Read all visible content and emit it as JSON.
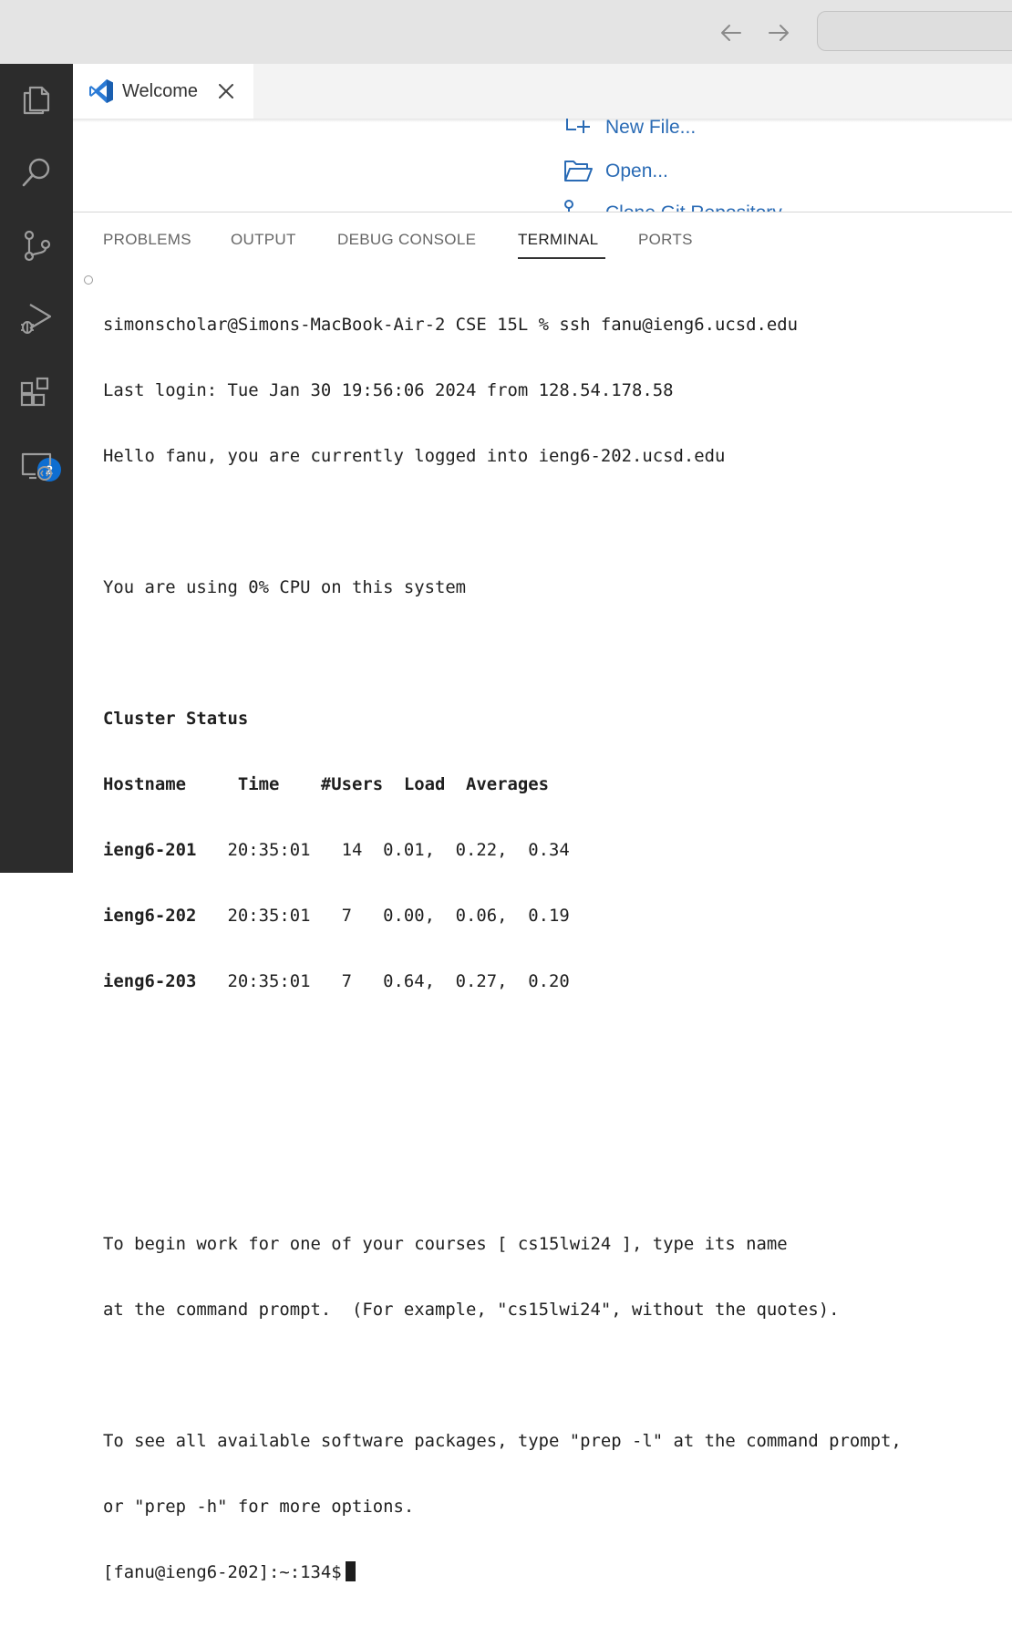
{
  "titlebar": {
    "back_icon": "arrow-left-icon",
    "forward_icon": "arrow-right-icon"
  },
  "activity_bar": {
    "items": [
      {
        "name": "explorer",
        "icon": "files-icon"
      },
      {
        "name": "search",
        "icon": "search-icon"
      },
      {
        "name": "source-control",
        "icon": "source-control-icon"
      },
      {
        "name": "run-debug",
        "icon": "run-debug-icon"
      },
      {
        "name": "extensions",
        "icon": "extensions-icon",
        "badge": "2"
      },
      {
        "name": "remote-explorer",
        "icon": "remote-explorer-icon"
      }
    ],
    "extensions_badge": "2"
  },
  "editor": {
    "tab": {
      "title": "Welcome",
      "icon": "vscode-icon",
      "close_icon": "close-icon"
    },
    "welcome_links": {
      "new_file": "New File...",
      "open": "Open...",
      "clone": "Clone Git Repository..."
    }
  },
  "panel": {
    "tabs": [
      "PROBLEMS",
      "OUTPUT",
      "DEBUG CONSOLE",
      "TERMINAL",
      "PORTS"
    ],
    "active_tab": "TERMINAL"
  },
  "terminal": {
    "command_line": "simonscholar@Simons-MacBook-Air-2 CSE 15L % ssh fanu@ieng6.ucsd.edu",
    "last_login": "Last login: Tue Jan 30 19:56:06 2024 from 128.54.178.58",
    "hello": "Hello fanu, you are currently logged into ieng6-202.ucsd.edu",
    "cpu": "You are using 0% CPU on this system",
    "cluster_title": "Cluster Status",
    "cluster_header": "Hostname     Time    #Users  Load  Averages",
    "cluster_rows": [
      {
        "host": "ieng6-201",
        "rest": "   20:35:01   14  0.01,  0.22,  0.34"
      },
      {
        "host": "ieng6-202",
        "rest": "   20:35:01   7   0.00,  0.06,  0.19"
      },
      {
        "host": "ieng6-203",
        "rest": "   20:35:01   7   0.64,  0.27,  0.20"
      }
    ],
    "begin_1": "To begin work for one of your courses [ cs15lwi24 ], type its name",
    "begin_2": "at the command prompt.  (For example, \"cs15lwi24\", without the quotes).",
    "prep_1": "To see all available software packages, type \"prep -l\" at the command prompt,",
    "prep_2": "or \"prep -h\" for more options.",
    "prompt": "[fanu@ieng6-202]:~:134$"
  }
}
